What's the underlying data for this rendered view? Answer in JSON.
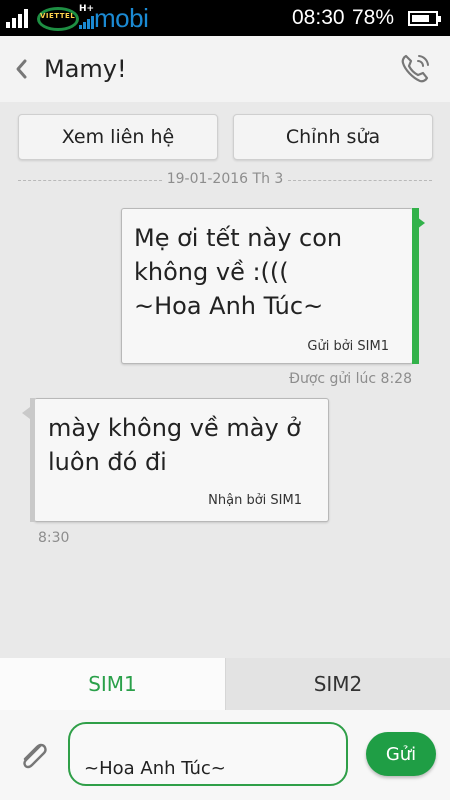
{
  "status_bar": {
    "carrier_logo_text": "VIETTEL",
    "network_type": "H+",
    "carrier2_name": "mobi",
    "time": "08:30",
    "battery_percent": "78%",
    "battery_level": 0.78,
    "icons": [
      "signal-icon",
      "signal-icon-2",
      "battery-icon"
    ]
  },
  "header": {
    "contact_name": "Mamy!",
    "back_icon": "chevron-left-icon",
    "call_icon": "phone-icon"
  },
  "actions": {
    "view_contact_label": "Xem liên hệ",
    "edit_label": "Chỉnh sửa"
  },
  "conversation": {
    "date_label": "19-01-2016 Th 3",
    "messages": [
      {
        "direction": "outgoing",
        "text": "Mẹ ơi tết này con\nkhông về :(((\n~Hoa Anh Túc~",
        "sim_label": "Gửi bởi SIM1",
        "time_label": "Được gửi lúc 8:28"
      },
      {
        "direction": "incoming",
        "text": "mày không về mày ở\nluôn đó đi",
        "sim_label": "Nhận bởi SIM1",
        "time_label": "8:30"
      }
    ]
  },
  "sim_tabs": [
    {
      "label": "SIM1",
      "active": true
    },
    {
      "label": "SIM2",
      "active": false
    }
  ],
  "compose": {
    "input_value": "~Hoa Anh Túc~",
    "send_label": "Gửi",
    "attach_icon": "paperclip-icon"
  },
  "colors": {
    "accent_green": "#2aa04a",
    "send_button": "#1f9e45",
    "carrier_blue": "#1b8ad3"
  }
}
